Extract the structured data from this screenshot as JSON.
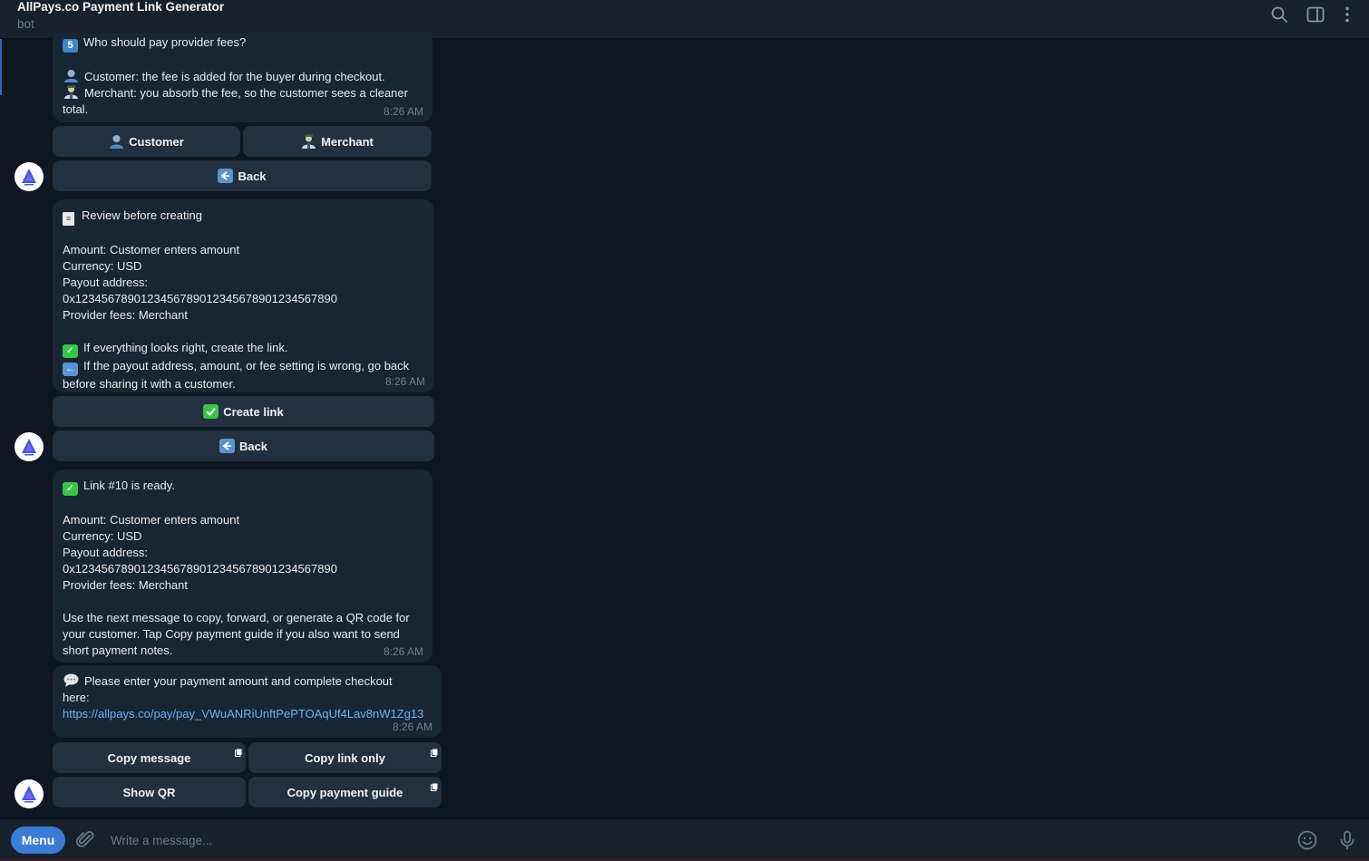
{
  "header": {
    "title": "AllPays.co Payment Link Generator",
    "subtitle": "bot"
  },
  "msg_fees": {
    "line1": "Who should pay provider fees?",
    "line1_keycap": "5",
    "customer_line": "Customer: the fee is added for the buyer during checkout.",
    "merchant_line_a": "Merchant: you absorb the fee, so the customer sees a cleaner",
    "merchant_line_b": "total.",
    "time": "8:26 AM",
    "btn_customer": "Customer",
    "btn_merchant": "Merchant",
    "btn_back": "Back"
  },
  "msg_review": {
    "title": "Review before creating",
    "amount": "Amount: Customer enters amount",
    "currency": "Currency: USD",
    "payout_label": "Payout address:",
    "payout_address": "0x1234567890123456789012345678901234567890",
    "fees": "Provider fees: Merchant",
    "hint_ok": "If everything looks right, create the link.",
    "hint_back_a": "If the payout address, amount, or fee setting is wrong, go back",
    "hint_back_b": "before sharing it with a customer.",
    "time": "8:26 AM",
    "btn_create": "Create link",
    "btn_back": "Back"
  },
  "msg_ready": {
    "title": "Link #10 is ready.",
    "amount": "Amount: Customer enters amount",
    "currency": "Currency: USD",
    "payout_label": "Payout address:",
    "payout_address": "0x1234567890123456789012345678901234567890",
    "fees": "Provider fees: Merchant",
    "note_a": "Use the next message to copy, forward, or generate a QR code for",
    "note_b": "your customer. Tap Copy payment guide if you also want to send",
    "note_c": "short payment notes.",
    "time": "8:26 AM"
  },
  "msg_link": {
    "line_a": "Please enter your payment amount and complete checkout",
    "line_b": "here:",
    "url": "https://allpays.co/pay/pay_VWuANRiUnftPePTOAqUf4Lav8nW1Zg13",
    "time": "8:26 AM",
    "btn_copy_message": "Copy message",
    "btn_copy_link": "Copy link only",
    "btn_show_qr": "Show QR",
    "btn_copy_guide": "Copy payment guide"
  },
  "composer": {
    "menu_label": "Menu",
    "placeholder": "Write a message..."
  },
  "colors": {
    "background": "#0e1621",
    "header": "#17212b",
    "bubble": "#182533",
    "keyboard_button": "#233040",
    "accent": "#3a7bd5",
    "link": "#6ab3f3"
  },
  "icons": {
    "header": [
      "search-icon",
      "sidebar-toggle-icon",
      "more-vertical-icon"
    ],
    "composer": [
      "paperclip-icon",
      "emoji-icon",
      "microphone-icon"
    ]
  }
}
